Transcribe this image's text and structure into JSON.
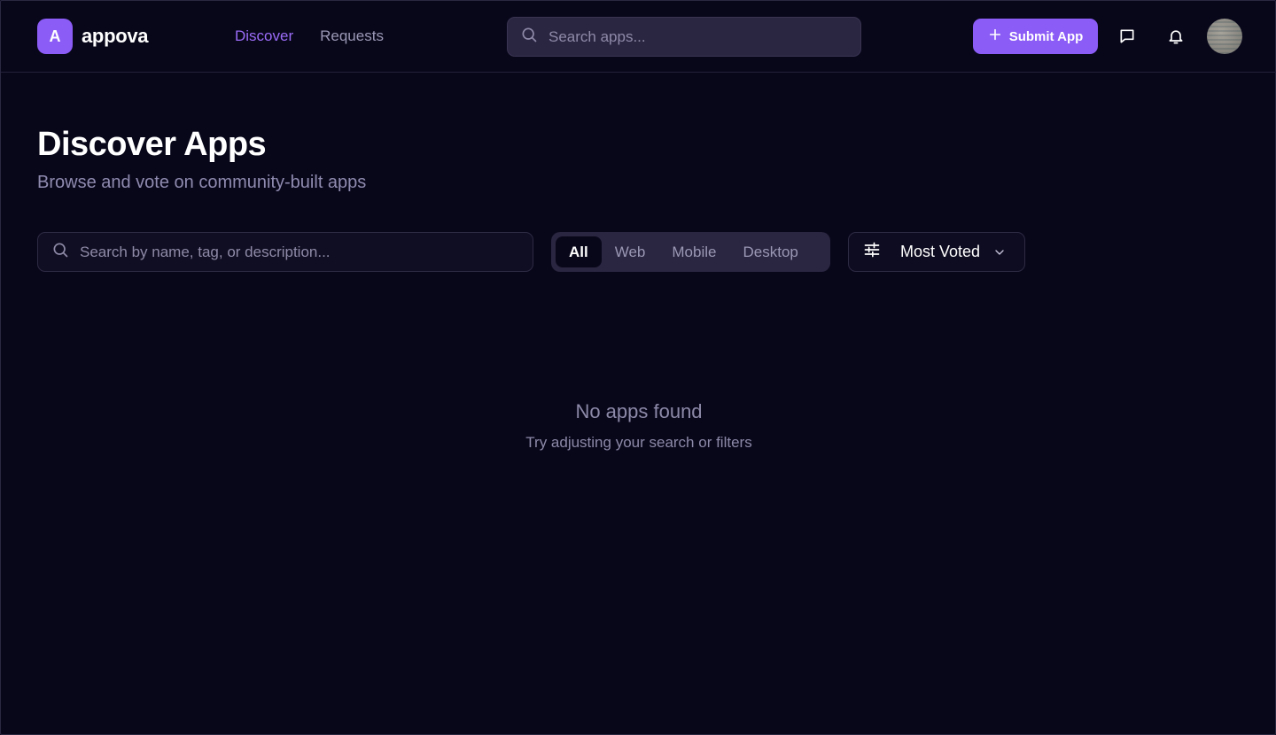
{
  "app": {
    "logo_letter": "A",
    "name": "appova"
  },
  "nav": {
    "items": [
      {
        "label": "Discover",
        "active": true
      },
      {
        "label": "Requests",
        "active": false
      }
    ]
  },
  "header": {
    "search_placeholder": "Search apps...",
    "submit_label": "Submit App",
    "icons": [
      "search-icon",
      "plus-icon",
      "message-icon",
      "bell-icon",
      "avatar"
    ]
  },
  "page": {
    "title": "Discover Apps",
    "subtitle": "Browse and vote on community-built apps"
  },
  "filters": {
    "search_placeholder": "Search by name, tag, or description...",
    "platforms": [
      {
        "label": "All",
        "active": true
      },
      {
        "label": "Web",
        "active": false
      },
      {
        "label": "Mobile",
        "active": false
      },
      {
        "label": "Desktop",
        "active": false
      }
    ],
    "sort_label": "Most Voted"
  },
  "empty_state": {
    "title": "No apps found",
    "subtitle": "Try adjusting your search or filters"
  },
  "colors": {
    "background": "#08071a",
    "accent": "#8b5cf6",
    "muted_text": "#8f8bb0"
  }
}
